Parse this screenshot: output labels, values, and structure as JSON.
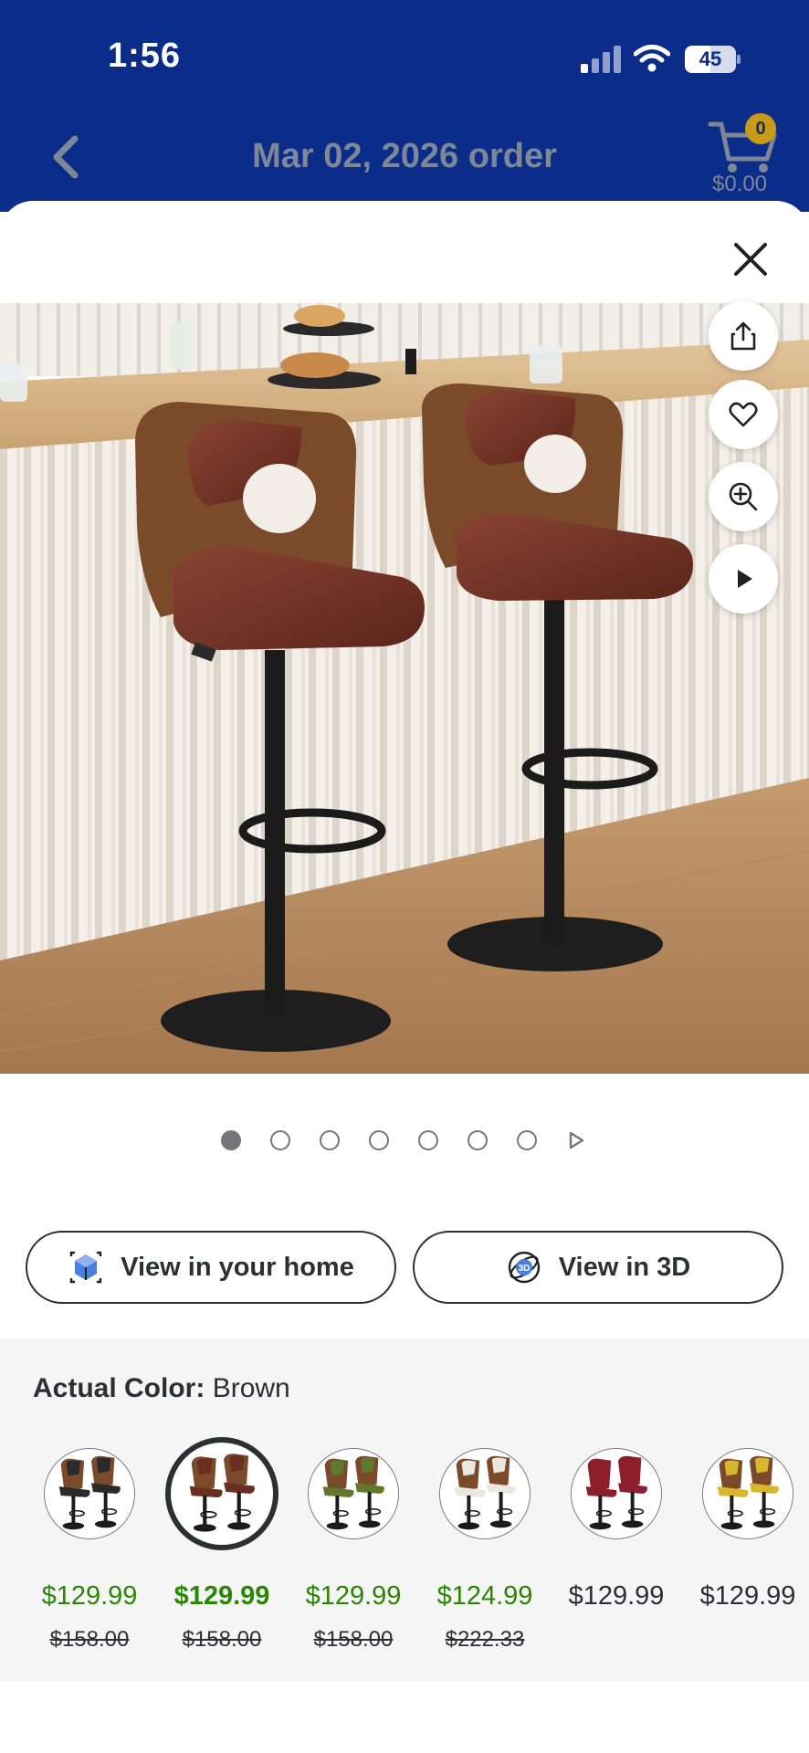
{
  "status_bar": {
    "time": "1:56",
    "battery": "45"
  },
  "header": {
    "title": "Mar 02, 2026 order",
    "cart_count": "0",
    "cart_total": "$0.00"
  },
  "gallery": {
    "total_images": 7,
    "active_index": 0
  },
  "actions": {
    "view_home_label": "View in your home",
    "view_3d_label": "View in 3D",
    "badge_3d": "3D"
  },
  "colors": {
    "label": "Actual Color:",
    "selected": "Brown",
    "swatches": [
      {
        "name": "Black",
        "seat": "#2b2a2a",
        "back": "#7a4a2a",
        "price": "$129.99",
        "was": "$158.00",
        "sale": true
      },
      {
        "name": "Brown",
        "seat": "#6b2f22",
        "back": "#7a4a2a",
        "price": "$129.99",
        "was": "$158.00",
        "sale": true
      },
      {
        "name": "Green",
        "seat": "#5e7a2a",
        "back": "#7a4a2a",
        "price": "$129.99",
        "was": "$158.00",
        "sale": true
      },
      {
        "name": "White",
        "seat": "#ece7df",
        "back": "#7a4a2a",
        "price": "$124.99",
        "was": "$222.33",
        "sale": true
      },
      {
        "name": "Red",
        "seat": "#8c1f2b",
        "back": "#8c1f2b",
        "price": "$129.99",
        "was": "",
        "sale": false
      },
      {
        "name": "Yellow",
        "seat": "#d8b62c",
        "back": "#7a4a2a",
        "price": "$129.99",
        "was": "",
        "sale": false
      }
    ]
  },
  "theme": {
    "header_bg": "#0b2c88",
    "sale_green": "#2a8703",
    "badge": "#c99a16"
  }
}
